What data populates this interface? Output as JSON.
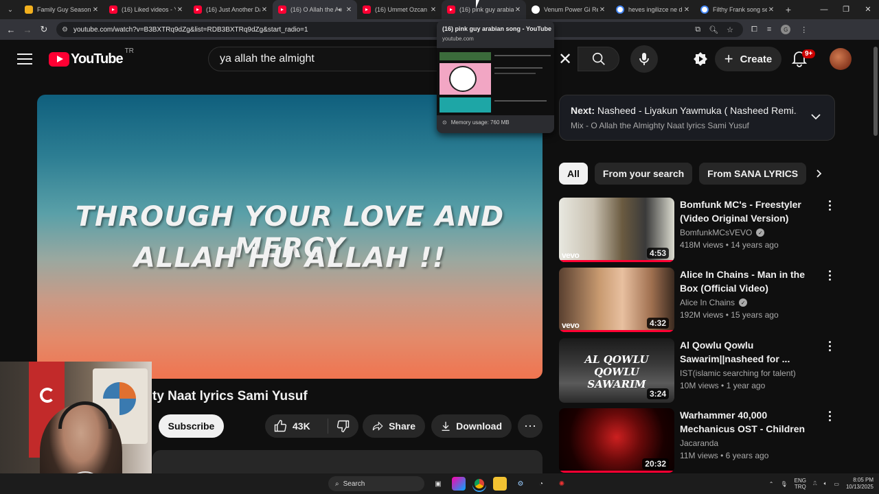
{
  "browser": {
    "tabs": [
      {
        "title": "Family Guy Season 23",
        "favicon": "family-guy"
      },
      {
        "title": "(16) Liked videos - Yo",
        "favicon": "youtube"
      },
      {
        "title": "(16) Just Another Day",
        "favicon": "youtube"
      },
      {
        "title": "(16) O Allah the Al",
        "favicon": "youtube",
        "active": true
      },
      {
        "title": "(16) Ummet Ozcan X",
        "favicon": "youtube"
      },
      {
        "title": "(16) pink guy arabian",
        "favicon": "youtube",
        "hovered": true
      },
      {
        "title": "Venum Power Gi Revi",
        "favicon": "github"
      },
      {
        "title": "heves ingilizce ne de",
        "favicon": "google"
      },
      {
        "title": "Filthy Frank song sea",
        "favicon": "google"
      }
    ],
    "url": "youtube.com/watch?v=B3BXTRq9dZg&list=RDB3BXTRq9dZg&start_radio=1",
    "profile_initial": "G"
  },
  "tooltip": {
    "title": "(16) pink guy arabian song - YouTube",
    "url": "youtube.com",
    "memory": "Memory usage: 760 MB"
  },
  "youtube": {
    "logo_text": "YouTube",
    "country": "TR",
    "search_query": "ya allah the almight",
    "create_label": "Create",
    "notification_count": "9+",
    "video": {
      "lyric_line1": "THROUGH YOUR LOVE AND MERCY",
      "lyric_line2": "ALLAH HU ALLAH !!",
      "title_visible": "ty Naat lyrics Sami Yusuf",
      "subscribe_label": "Subscribe",
      "likes": "43K",
      "share_label": "Share",
      "download_label": "Download"
    },
    "up_next": {
      "prefix": "Next:",
      "title": "Nasheed - Liyakun Yawmuka ( Nasheed Remi...",
      "mix": "Mix - O Allah the Almighty Naat lyrics Sami Yusuf"
    },
    "chips": [
      "All",
      "From your search",
      "From SANA LYRICS"
    ],
    "recommendations": [
      {
        "title": "Bomfunk MC's - Freestyler (Video Original Version)",
        "channel": "BomfunkMCsVEVO",
        "verified": true,
        "views": "418M views",
        "age": "14 years ago",
        "duration": "4:53",
        "vevo": "vevo"
      },
      {
        "title": "Alice In Chains - Man in the Box (Official Video)",
        "channel": "Alice In Chains",
        "verified": true,
        "views": "192M views",
        "age": "15 years ago",
        "duration": "4:32",
        "vevo": "vevo"
      },
      {
        "title": "Al Qowlu Qowlu Sawarim||nasheed for ...",
        "channel": "IST(islamic searching for talent)",
        "verified": false,
        "views": "10M views",
        "age": "1 year ago",
        "duration": "3:24",
        "thumb_text": "AL QOWLU QOWLU SAWARIM"
      },
      {
        "title": "Warhammer 40,000 Mechanicus OST  - Children of...",
        "channel": "Jacaranda",
        "verified": false,
        "views": "11M views",
        "age": "6 years ago",
        "duration": "20:32"
      }
    ]
  },
  "taskbar": {
    "search_label": "Search",
    "lang1": "ENG",
    "lang2": "TRQ",
    "time": "8:05 PM",
    "date": "10/13/2025"
  }
}
